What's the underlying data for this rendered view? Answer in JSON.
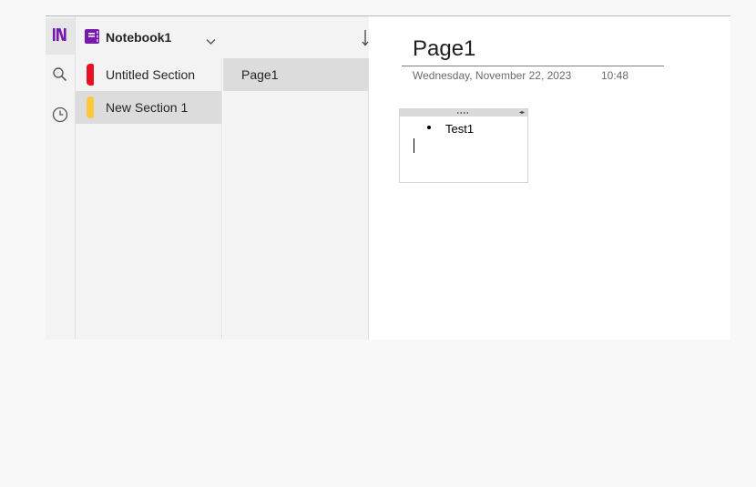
{
  "notebook": {
    "name": "Notebook1",
    "icon": "notebook-icon",
    "color": "#7719aa"
  },
  "rail": {
    "items": [
      {
        "name": "notebooks",
        "icon": "library-icon"
      },
      {
        "name": "search",
        "icon": "search-icon"
      },
      {
        "name": "recent",
        "icon": "clock-icon"
      }
    ]
  },
  "toolbar": {
    "sort_icon": "sort-icon"
  },
  "sections": [
    {
      "label": "Untitled Section",
      "color": "#e81123",
      "selected": false
    },
    {
      "label": "New Section 1",
      "color": "#ffc83d",
      "selected": true
    }
  ],
  "pages": [
    {
      "label": "Page1",
      "selected": true
    }
  ],
  "canvas": {
    "title": "Page1",
    "date": "Wednesday, November 22, 2023",
    "time": "10:48",
    "note": {
      "bullets": [
        "Test1"
      ]
    }
  }
}
